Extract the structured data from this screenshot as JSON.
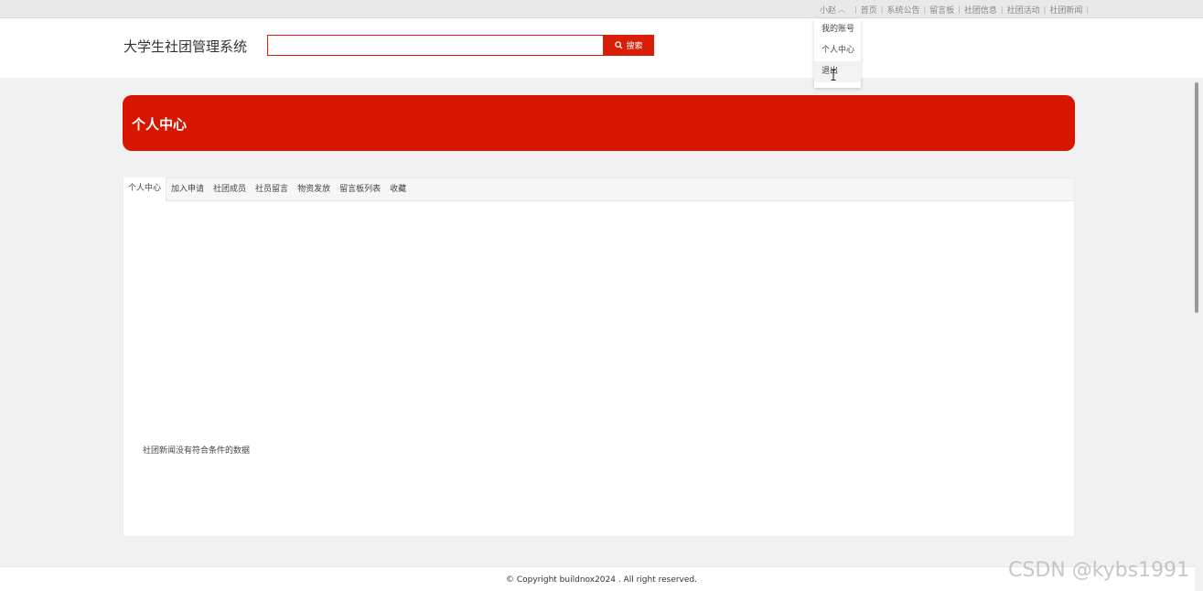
{
  "topbar": {
    "user_name": "小赵",
    "nav": [
      "首页",
      "系统公告",
      "留言板",
      "社团信息",
      "社团活动",
      "社团新闻"
    ]
  },
  "header": {
    "site_title": "大学生社团管理系统",
    "search_placeholder": "",
    "search_button": "搜索"
  },
  "dropdown": {
    "items": [
      "我的账号",
      "个人中心",
      "退出"
    ]
  },
  "banner": {
    "title": "个人中心"
  },
  "tabs": [
    "个人中心",
    "加入申请",
    "社团成员",
    "社员留言",
    "物资发放",
    "留言板列表",
    "收藏"
  ],
  "main": {
    "empty_message": "社团新闻没有符合条件的数据"
  },
  "footer": {
    "copyright": "© Copyright buildnox2024 . All right reserved."
  },
  "watermark": "CSDN @kybs1991",
  "colors": {
    "accent": "#d81600",
    "search_border": "#d81e06"
  }
}
